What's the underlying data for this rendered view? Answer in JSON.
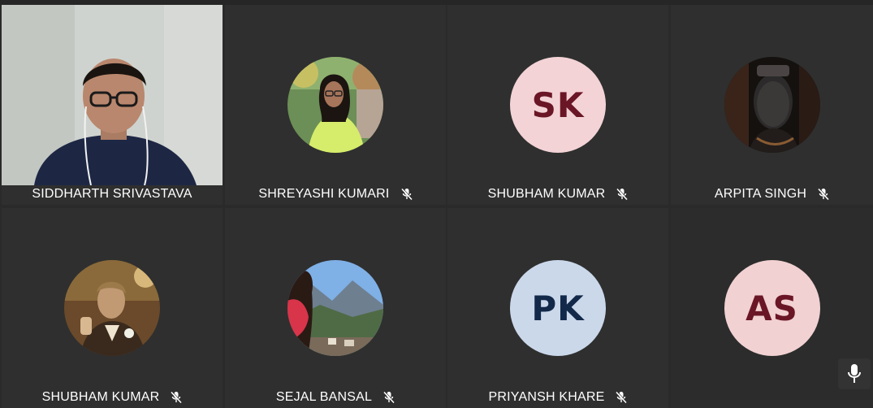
{
  "participants": [
    {
      "name": "SIDDHARTH SRIVASTAVA",
      "muted": false,
      "type": "video"
    },
    {
      "name": "SHREYASHI KUMARI",
      "muted": true,
      "type": "photo"
    },
    {
      "name": "SHUBHAM KUMAR",
      "muted": true,
      "type": "initials",
      "initials": "SK",
      "bg": "#f3d3d6",
      "fg": "#6a1626"
    },
    {
      "name": "ARPITA SINGH",
      "muted": true,
      "type": "photo"
    },
    {
      "name": "SHUBHAM KUMAR",
      "muted": true,
      "type": "photo"
    },
    {
      "name": "SEJAL BANSAL",
      "muted": true,
      "type": "photo"
    },
    {
      "name": "PRIYANSH KHARE",
      "muted": true,
      "type": "initials",
      "initials": "PK",
      "bg": "#cad8ea",
      "fg": "#13294a"
    },
    {
      "name": "",
      "muted": false,
      "type": "initials",
      "initials": "AS",
      "bg": "#f1d1d2",
      "fg": "#6a1626"
    }
  ],
  "controls": {
    "mic_icon": "microphone-icon",
    "mute_icon": "mic-off-icon"
  },
  "colors": {
    "tile_bg": "#2f2f2f",
    "name_text": "#ffffff",
    "background": "#2a2a2a"
  }
}
